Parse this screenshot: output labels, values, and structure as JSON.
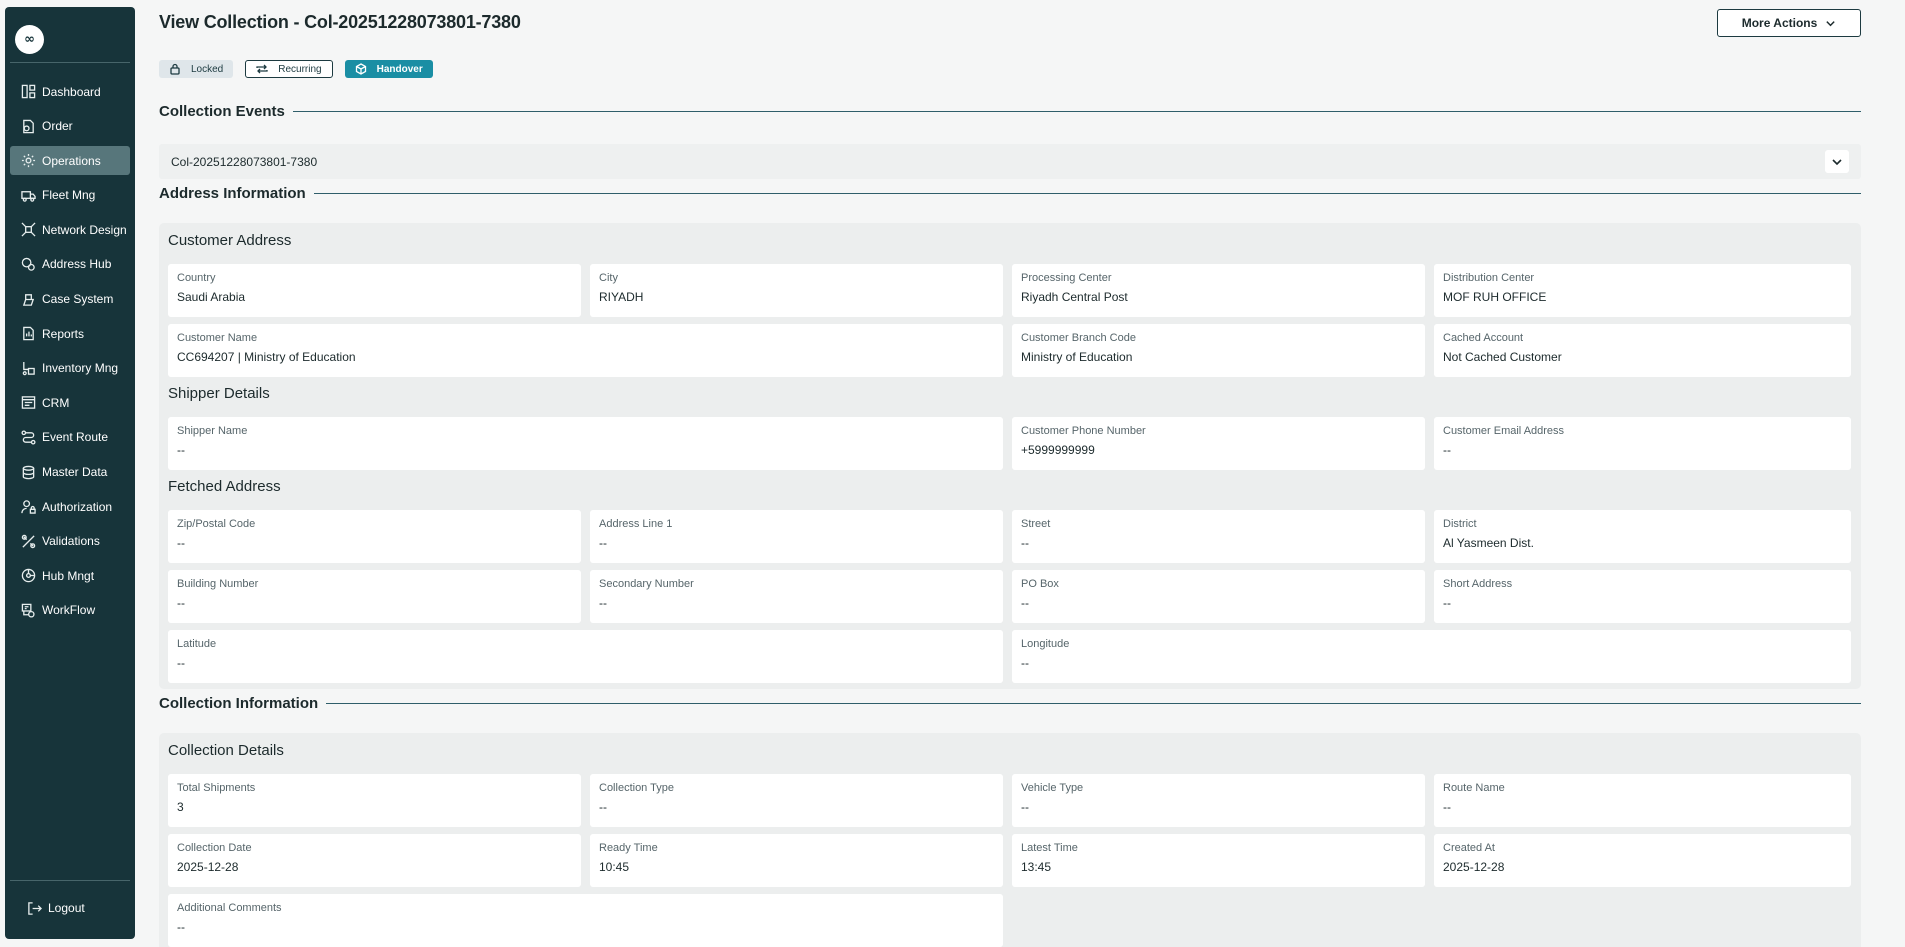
{
  "sidebar": {
    "logo": "∞",
    "items": [
      {
        "label": "Dashboard",
        "icon": "dashboard-icon"
      },
      {
        "label": "Order",
        "icon": "order-icon"
      },
      {
        "label": "Operations",
        "icon": "operations-icon",
        "active": true
      },
      {
        "label": "Fleet Mng",
        "icon": "truck-icon"
      },
      {
        "label": "Network Design",
        "icon": "network-icon"
      },
      {
        "label": "Address Hub",
        "icon": "map-pin-icon"
      },
      {
        "label": "Case System",
        "icon": "case-icon"
      },
      {
        "label": "Reports",
        "icon": "report-icon"
      },
      {
        "label": "Inventory Mng",
        "icon": "inventory-icon"
      },
      {
        "label": "CRM",
        "icon": "crm-icon"
      },
      {
        "label": "Event Route",
        "icon": "route-icon"
      },
      {
        "label": "Master Data",
        "icon": "database-icon"
      },
      {
        "label": "Authorization",
        "icon": "user-lock-icon"
      },
      {
        "label": "Validations",
        "icon": "validation-icon"
      },
      {
        "label": "Hub Mngt",
        "icon": "hub-icon"
      },
      {
        "label": "WorkFlow",
        "icon": "workflow-icon"
      }
    ],
    "logout": "Logout"
  },
  "header": {
    "title": "View Collection - Col-20251228073801-7380",
    "more_actions": "More Actions"
  },
  "badges": {
    "locked": "Locked",
    "recurring": "Recurring",
    "handover": "Handover"
  },
  "collection_events": {
    "heading": "Collection Events",
    "event_id": "Col-20251228073801-7380"
  },
  "address_information": {
    "heading": "Address Information",
    "customer_address": {
      "heading": "Customer Address",
      "country": {
        "label": "Country",
        "value": "Saudi Arabia"
      },
      "city": {
        "label": "City",
        "value": "RIYADH"
      },
      "processing_center": {
        "label": "Processing Center",
        "value": "Riyadh Central Post"
      },
      "distribution_center": {
        "label": "Distribution Center",
        "value": "MOF RUH OFFICE"
      },
      "customer_name": {
        "label": "Customer Name",
        "value": "CC694207 | Ministry of Education"
      },
      "customer_branch_code": {
        "label": "Customer Branch Code",
        "value": "Ministry of Education"
      },
      "cached_account": {
        "label": "Cached Account",
        "value": "Not Cached Customer"
      }
    },
    "shipper_details": {
      "heading": "Shipper Details",
      "shipper_name": {
        "label": "Shipper Name",
        "value": "--"
      },
      "customer_phone": {
        "label": "Customer Phone Number",
        "value": "+5999999999"
      },
      "customer_email": {
        "label": "Customer Email Address",
        "value": "--"
      }
    },
    "fetched_address": {
      "heading": "Fetched Address",
      "zip": {
        "label": "Zip/Postal Code",
        "value": "--"
      },
      "address_line_1": {
        "label": "Address Line 1",
        "value": "--"
      },
      "street": {
        "label": "Street",
        "value": "--"
      },
      "district": {
        "label": "District",
        "value": "Al Yasmeen Dist."
      },
      "building_number": {
        "label": "Building Number",
        "value": "--"
      },
      "secondary_number": {
        "label": "Secondary Number",
        "value": "--"
      },
      "po_box": {
        "label": "PO Box",
        "value": "--"
      },
      "short_address": {
        "label": "Short Address",
        "value": "--"
      },
      "latitude": {
        "label": "Latitude",
        "value": "--"
      },
      "longitude": {
        "label": "Longitude",
        "value": "--"
      }
    }
  },
  "collection_information": {
    "heading": "Collection Information",
    "details": {
      "heading": "Collection Details",
      "total_shipments": {
        "label": "Total Shipments",
        "value": "3"
      },
      "collection_type": {
        "label": "Collection Type",
        "value": "--"
      },
      "vehicle_type": {
        "label": "Vehicle Type",
        "value": "--"
      },
      "route_name": {
        "label": "Route Name",
        "value": "--"
      },
      "collection_date": {
        "label": "Collection Date",
        "value": "2025-12-28"
      },
      "ready_time": {
        "label": "Ready Time",
        "value": "10:45"
      },
      "latest_time": {
        "label": "Latest Time",
        "value": "13:45"
      },
      "created_at": {
        "label": "Created At",
        "value": "2025-12-28"
      },
      "additional_comments": {
        "label": "Additional Comments",
        "value": "--"
      }
    }
  }
}
